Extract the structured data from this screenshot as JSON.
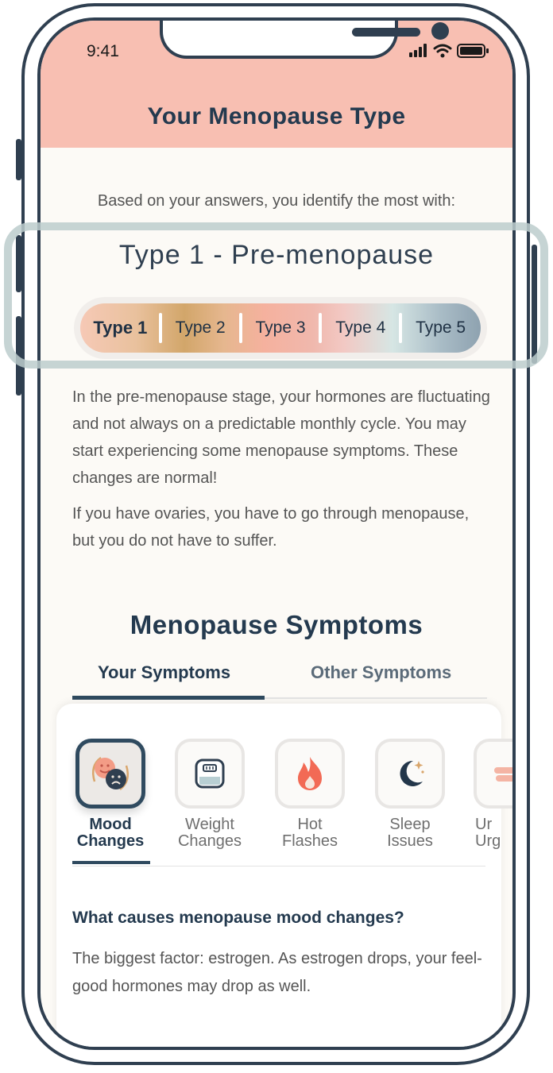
{
  "status_bar": {
    "time": "9:41"
  },
  "header": {
    "title": "Your Menopause Type"
  },
  "result": {
    "intro": "Based on your answers, you identify the most with:",
    "type_name": "Type 1 - Pre-menopause",
    "types": [
      "Type 1",
      "Type 2",
      "Type 3",
      "Type 4",
      "Type 5"
    ],
    "selected_index": 0
  },
  "description": {
    "para1": "In the pre-menopause stage, your hormones are fluctuating and not always on a predictable monthly cycle. You may start experiencing some menopause symptoms. These changes are normal!",
    "para2": "If you have ovaries, you have to go through menopause, but you do not have to suffer."
  },
  "symptoms": {
    "section_title": "Menopause Symptoms",
    "tabs": [
      "Your Symptoms",
      "Other Symptoms"
    ],
    "items": [
      {
        "line1": "Mood",
        "line2": "Changes",
        "icon": "mood-faces-icon"
      },
      {
        "line1": "Weight",
        "line2": "Changes",
        "icon": "scale-icon"
      },
      {
        "line1": "Hot",
        "line2": "Flashes",
        "icon": "flame-icon"
      },
      {
        "line1": "Sleep",
        "line2": "Issues",
        "icon": "moon-stars-icon"
      },
      {
        "line1": "Ur",
        "line2": "Urg",
        "icon": "partial-icon"
      }
    ],
    "question": "What causes menopause mood changes?",
    "answer": "The biggest factor: estrogen. As estrogen drops, your feel-good hormones may drop as well."
  },
  "colors": {
    "navy": "#243a4f",
    "header_bg": "#f8bfb2",
    "page_bg": "#fcfaf6",
    "highlight": "#bccccc"
  }
}
